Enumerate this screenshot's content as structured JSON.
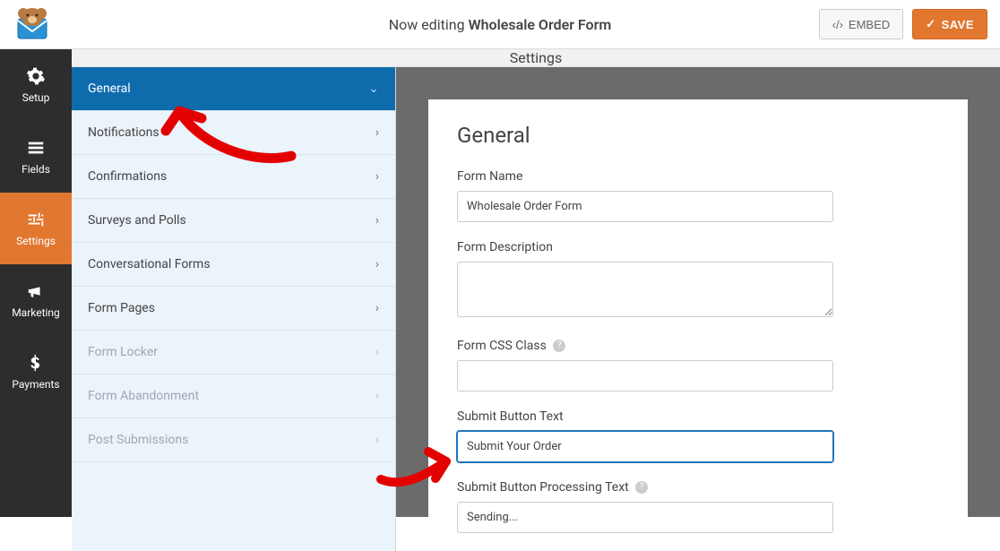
{
  "top": {
    "editing_prefix": "Now editing ",
    "form_title": "Wholesale Order Form",
    "embed_label": "EMBED",
    "save_label": "SAVE"
  },
  "nav": {
    "setup": "Setup",
    "fields": "Fields",
    "settings": "Settings",
    "marketing": "Marketing",
    "payments": "Payments"
  },
  "content_header": "Settings",
  "side": {
    "items": [
      {
        "label": "General",
        "active": true,
        "disabled": false
      },
      {
        "label": "Notifications",
        "active": false,
        "disabled": false
      },
      {
        "label": "Confirmations",
        "active": false,
        "disabled": false
      },
      {
        "label": "Surveys and Polls",
        "active": false,
        "disabled": false
      },
      {
        "label": "Conversational Forms",
        "active": false,
        "disabled": false
      },
      {
        "label": "Form Pages",
        "active": false,
        "disabled": false
      },
      {
        "label": "Form Locker",
        "active": false,
        "disabled": true
      },
      {
        "label": "Form Abandonment",
        "active": false,
        "disabled": true
      },
      {
        "label": "Post Submissions",
        "active": false,
        "disabled": true
      }
    ]
  },
  "panel": {
    "heading": "General",
    "form_name_label": "Form Name",
    "form_name_value": "Wholesale Order Form",
    "form_desc_label": "Form Description",
    "form_desc_value": "",
    "form_css_label": "Form CSS Class",
    "form_css_value": "",
    "submit_text_label": "Submit Button Text",
    "submit_text_value": "Submit Your Order",
    "submit_processing_label": "Submit Button Processing Text",
    "submit_processing_value": "Sending..."
  }
}
